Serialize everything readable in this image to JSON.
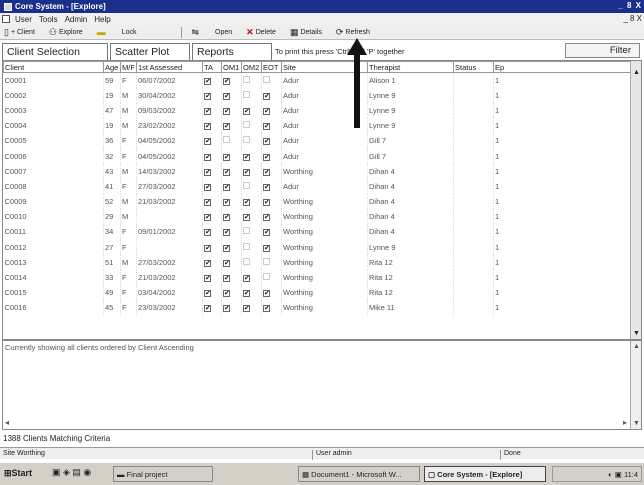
{
  "window": {
    "title": "Core System - [Explore]",
    "controls": "_ 8 X"
  },
  "menu": {
    "items": [
      "User",
      "Tools",
      "Admin",
      "Help"
    ],
    "mdi_controls": "_ 8 X"
  },
  "toolbar": {
    "buttons": [
      {
        "label": "+ Client",
        "icon": "new-doc-icon"
      },
      {
        "label": "Explore",
        "icon": "binoculars-icon"
      },
      {
        "label": "",
        "icon": "folder-icon"
      },
      {
        "label": "Lock",
        "icon": "lock-icon"
      },
      {
        "label": "",
        "icon": "export-icon"
      },
      {
        "label": "Open",
        "icon": "open-icon"
      },
      {
        "label": "Delete",
        "icon": "delete-x-icon"
      },
      {
        "label": "Details",
        "icon": "details-icon"
      },
      {
        "label": "Refresh",
        "icon": "refresh-icon"
      }
    ]
  },
  "tabs": {
    "items": [
      "Client Selection",
      "Scatter Plot",
      "Reports"
    ],
    "print_hint": "To print this press 'Ctrl' and 'P' together",
    "filter_label": "Filter"
  },
  "grid": {
    "columns": [
      "Client",
      "Age",
      "M/F",
      "1st Assessed",
      "TA",
      "OM1",
      "OM2",
      "EOT",
      "Site",
      "Therapist",
      "Status",
      "Ep"
    ],
    "rows": [
      {
        "client": "C0001",
        "age": "59",
        "sex": "F",
        "assessed": "06/07/2002",
        "ta": "✔",
        "om1": "✔",
        "om2": "",
        "eot": "",
        "site": "Adur",
        "therapist": "Alison 1",
        "status": "",
        "ep": "1"
      },
      {
        "client": "C0002",
        "age": "19",
        "sex": "M",
        "assessed": "30/04/2002",
        "ta": "✔",
        "om1": "✔",
        "om2": "",
        "eot": "✔",
        "site": "Adur",
        "therapist": "Lynne 9",
        "status": "",
        "ep": "1"
      },
      {
        "client": "C0003",
        "age": "47",
        "sex": "M",
        "assessed": "09/03/2002",
        "ta": "✔",
        "om1": "✔",
        "om2": "✔",
        "eot": "✔",
        "site": "Adur",
        "therapist": "Lynne 9",
        "status": "",
        "ep": "1"
      },
      {
        "client": "C0004",
        "age": "19",
        "sex": "M",
        "assessed": "23/02/2002",
        "ta": "✔",
        "om1": "✔",
        "om2": "",
        "eot": "✔",
        "site": "Adur",
        "therapist": "Lynne 9",
        "status": "",
        "ep": "1"
      },
      {
        "client": "C0005",
        "age": "36",
        "sex": "F",
        "assessed": "04/05/2002",
        "ta": "✔",
        "om1": "",
        "om2": "",
        "eot": "✔",
        "site": "Adur",
        "therapist": "Gill 7",
        "status": "",
        "ep": "1"
      },
      {
        "client": "C0006",
        "age": "32",
        "sex": "F",
        "assessed": "04/05/2002",
        "ta": "✔",
        "om1": "✔",
        "om2": "✔",
        "eot": "✔",
        "site": "Adur",
        "therapist": "Gill 7",
        "status": "",
        "ep": "1"
      },
      {
        "client": "C0007",
        "age": "43",
        "sex": "M",
        "assessed": "14/03/2002",
        "ta": "✔",
        "om1": "✔",
        "om2": "✔",
        "eot": "✔",
        "site": "Worthing",
        "therapist": "Dihan 4",
        "status": "",
        "ep": "1"
      },
      {
        "client": "C0008",
        "age": "41",
        "sex": "F",
        "assessed": "27/03/2002",
        "ta": "✔",
        "om1": "✔",
        "om2": "",
        "eot": "✔",
        "site": "Adur",
        "therapist": "Dihan 4",
        "status": "",
        "ep": "1"
      },
      {
        "client": "C0009",
        "age": "52",
        "sex": "M",
        "assessed": "21/03/2002",
        "ta": "✔",
        "om1": "✔",
        "om2": "✔",
        "eot": "✔",
        "site": "Worthing",
        "therapist": "Dihan 4",
        "status": "",
        "ep": "1"
      },
      {
        "client": "C0010",
        "age": "29",
        "sex": "M",
        "assessed": "",
        "ta": "✔",
        "om1": "✔",
        "om2": "✔",
        "eot": "✔",
        "site": "Worthing",
        "therapist": "Dihan 4",
        "status": "",
        "ep": "1"
      },
      {
        "client": "C0011",
        "age": "34",
        "sex": "F",
        "assessed": "09/01/2002",
        "ta": "✔",
        "om1": "✔",
        "om2": "",
        "eot": "✔",
        "site": "Worthing",
        "therapist": "Dihan 4",
        "status": "",
        "ep": "1"
      },
      {
        "client": "C0012",
        "age": "27",
        "sex": "F",
        "assessed": "",
        "ta": "✔",
        "om1": "✔",
        "om2": "",
        "eot": "✔",
        "site": "Worthing",
        "therapist": "Lynne 9",
        "status": "",
        "ep": "1"
      },
      {
        "client": "C0013",
        "age": "51",
        "sex": "M",
        "assessed": "27/03/2002",
        "ta": "✔",
        "om1": "✔",
        "om2": "",
        "eot": "",
        "site": "Worthing",
        "therapist": "Rita 12",
        "status": "",
        "ep": "1"
      },
      {
        "client": "C0014",
        "age": "33",
        "sex": "F",
        "assessed": "21/03/2002",
        "ta": "✔",
        "om1": "✔",
        "om2": "✔",
        "eot": "",
        "site": "Worthing",
        "therapist": "Rita 12",
        "status": "",
        "ep": "1"
      },
      {
        "client": "C0015",
        "age": "49",
        "sex": "F",
        "assessed": "03/04/2002",
        "ta": "✔",
        "om1": "✔",
        "om2": "✔",
        "eot": "✔",
        "site": "Worthing",
        "therapist": "Rita 12",
        "status": "",
        "ep": "1"
      },
      {
        "client": "C0016",
        "age": "45",
        "sex": "F",
        "assessed": "23/03/2002",
        "ta": "✔",
        "om1": "✔",
        "om2": "✔",
        "eot": "✔",
        "site": "Worthing",
        "therapist": "Mike 11",
        "status": "",
        "ep": "1"
      }
    ]
  },
  "description": "Currently showing all clients ordered by Client Ascending",
  "count_text": "1388 Clients Matching Criteria",
  "status": {
    "site": "Site Worthing",
    "user": "User admin",
    "state": "Done"
  },
  "taskbar": {
    "start_label": "Start",
    "tasks": [
      {
        "label": "Final project",
        "active": false
      },
      {
        "label": "Document1 - Microsoft W...",
        "active": false
      },
      {
        "label": "Core System - [Explore]",
        "active": true
      }
    ],
    "clock": "11:4"
  }
}
